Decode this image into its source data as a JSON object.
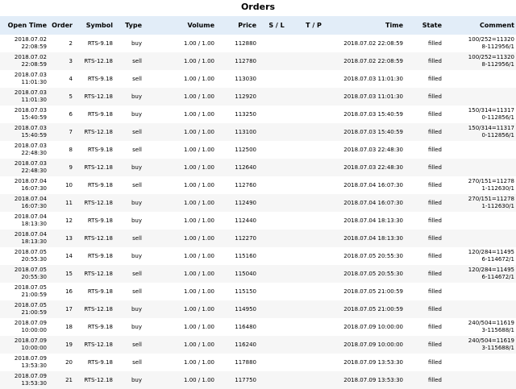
{
  "title": "Orders",
  "columns": [
    "Open Time",
    "Order",
    "Symbol",
    "Type",
    "Volume",
    "Price",
    "S / L",
    "T / P",
    "Time",
    "State",
    "Comment"
  ],
  "rows": [
    {
      "open1": "2018.07.02",
      "open2": "22:08:59",
      "order": "2",
      "symbol": "RTS-9.18",
      "type": "buy",
      "volume": "1.00 / 1.00",
      "price": "112880",
      "sl": "",
      "tp": "",
      "time": "2018.07.02 22:08:59",
      "state": "filled",
      "comment": "100/252=113208-112956/1"
    },
    {
      "open1": "2018.07.02",
      "open2": "22:08:59",
      "order": "3",
      "symbol": "RTS-12.18",
      "type": "sell",
      "volume": "1.00 / 1.00",
      "price": "112780",
      "sl": "",
      "tp": "",
      "time": "2018.07.02 22:08:59",
      "state": "filled",
      "comment": "100/252=113208-112956/1"
    },
    {
      "open1": "2018.07.03",
      "open2": "11:01:30",
      "order": "4",
      "symbol": "RTS-9.18",
      "type": "sell",
      "volume": "1.00 / 1.00",
      "price": "113030",
      "sl": "",
      "tp": "",
      "time": "2018.07.03 11:01:30",
      "state": "filled",
      "comment": ""
    },
    {
      "open1": "2018.07.03",
      "open2": "11:01:30",
      "order": "5",
      "symbol": "RTS-12.18",
      "type": "buy",
      "volume": "1.00 / 1.00",
      "price": "112920",
      "sl": "",
      "tp": "",
      "time": "2018.07.03 11:01:30",
      "state": "filled",
      "comment": ""
    },
    {
      "open1": "2018.07.03",
      "open2": "15:40:59",
      "order": "6",
      "symbol": "RTS-9.18",
      "type": "buy",
      "volume": "1.00 / 1.00",
      "price": "113250",
      "sl": "",
      "tp": "",
      "time": "2018.07.03 15:40:59",
      "state": "filled",
      "comment": "150/314=113170-112856/1"
    },
    {
      "open1": "2018.07.03",
      "open2": "15:40:59",
      "order": "7",
      "symbol": "RTS-12.18",
      "type": "sell",
      "volume": "1.00 / 1.00",
      "price": "113100",
      "sl": "",
      "tp": "",
      "time": "2018.07.03 15:40:59",
      "state": "filled",
      "comment": "150/314=113170-112856/1"
    },
    {
      "open1": "2018.07.03",
      "open2": "22:48:30",
      "order": "8",
      "symbol": "RTS-9.18",
      "type": "sell",
      "volume": "1.00 / 1.00",
      "price": "112500",
      "sl": "",
      "tp": "",
      "time": "2018.07.03 22:48:30",
      "state": "filled",
      "comment": ""
    },
    {
      "open1": "2018.07.03",
      "open2": "22:48:30",
      "order": "9",
      "symbol": "RTS-12.18",
      "type": "buy",
      "volume": "1.00 / 1.00",
      "price": "112640",
      "sl": "",
      "tp": "",
      "time": "2018.07.03 22:48:30",
      "state": "filled",
      "comment": ""
    },
    {
      "open1": "2018.07.04",
      "open2": "16:07:30",
      "order": "10",
      "symbol": "RTS-9.18",
      "type": "sell",
      "volume": "1.00 / 1.00",
      "price": "112760",
      "sl": "",
      "tp": "",
      "time": "2018.07.04 16:07:30",
      "state": "filled",
      "comment": "270/151=112781-112630/1"
    },
    {
      "open1": "2018.07.04",
      "open2": "16:07:30",
      "order": "11",
      "symbol": "RTS-12.18",
      "type": "buy",
      "volume": "1.00 / 1.00",
      "price": "112490",
      "sl": "",
      "tp": "",
      "time": "2018.07.04 16:07:30",
      "state": "filled",
      "comment": "270/151=112781-112630/1"
    },
    {
      "open1": "2018.07.04",
      "open2": "18:13:30",
      "order": "12",
      "symbol": "RTS-9.18",
      "type": "buy",
      "volume": "1.00 / 1.00",
      "price": "112440",
      "sl": "",
      "tp": "",
      "time": "2018.07.04 18:13:30",
      "state": "filled",
      "comment": ""
    },
    {
      "open1": "2018.07.04",
      "open2": "18:13:30",
      "order": "13",
      "symbol": "RTS-12.18",
      "type": "sell",
      "volume": "1.00 / 1.00",
      "price": "112270",
      "sl": "",
      "tp": "",
      "time": "2018.07.04 18:13:30",
      "state": "filled",
      "comment": ""
    },
    {
      "open1": "2018.07.05",
      "open2": "20:55:30",
      "order": "14",
      "symbol": "RTS-9.18",
      "type": "buy",
      "volume": "1.00 / 1.00",
      "price": "115160",
      "sl": "",
      "tp": "",
      "time": "2018.07.05 20:55:30",
      "state": "filled",
      "comment": "120/284=114956-114672/1"
    },
    {
      "open1": "2018.07.05",
      "open2": "20:55:30",
      "order": "15",
      "symbol": "RTS-12.18",
      "type": "sell",
      "volume": "1.00 / 1.00",
      "price": "115040",
      "sl": "",
      "tp": "",
      "time": "2018.07.05 20:55:30",
      "state": "filled",
      "comment": "120/284=114956-114672/1"
    },
    {
      "open1": "2018.07.05",
      "open2": "21:00:59",
      "order": "16",
      "symbol": "RTS-9.18",
      "type": "sell",
      "volume": "1.00 / 1.00",
      "price": "115150",
      "sl": "",
      "tp": "",
      "time": "2018.07.05 21:00:59",
      "state": "filled",
      "comment": ""
    },
    {
      "open1": "2018.07.05",
      "open2": "21:00:59",
      "order": "17",
      "symbol": "RTS-12.18",
      "type": "buy",
      "volume": "1.00 / 1.00",
      "price": "114950",
      "sl": "",
      "tp": "",
      "time": "2018.07.05 21:00:59",
      "state": "filled",
      "comment": ""
    },
    {
      "open1": "2018.07.09",
      "open2": "10:00:00",
      "order": "18",
      "symbol": "RTS-9.18",
      "type": "buy",
      "volume": "1.00 / 1.00",
      "price": "116480",
      "sl": "",
      "tp": "",
      "time": "2018.07.09 10:00:00",
      "state": "filled",
      "comment": "240/504=116193-115688/1"
    },
    {
      "open1": "2018.07.09",
      "open2": "10:00:00",
      "order": "19",
      "symbol": "RTS-12.18",
      "type": "sell",
      "volume": "1.00 / 1.00",
      "price": "116240",
      "sl": "",
      "tp": "",
      "time": "2018.07.09 10:00:00",
      "state": "filled",
      "comment": "240/504=116193-115688/1"
    },
    {
      "open1": "2018.07.09",
      "open2": "13:53:30",
      "order": "20",
      "symbol": "RTS-9.18",
      "type": "sell",
      "volume": "1.00 / 1.00",
      "price": "117880",
      "sl": "",
      "tp": "",
      "time": "2018.07.09 13:53:30",
      "state": "filled",
      "comment": ""
    },
    {
      "open1": "2018.07.09",
      "open2": "13:53:30",
      "order": "21",
      "symbol": "RTS-12.18",
      "type": "buy",
      "volume": "1.00 / 1.00",
      "price": "117750",
      "sl": "",
      "tp": "",
      "time": "2018.07.09 13:53:30",
      "state": "filled",
      "comment": ""
    }
  ]
}
